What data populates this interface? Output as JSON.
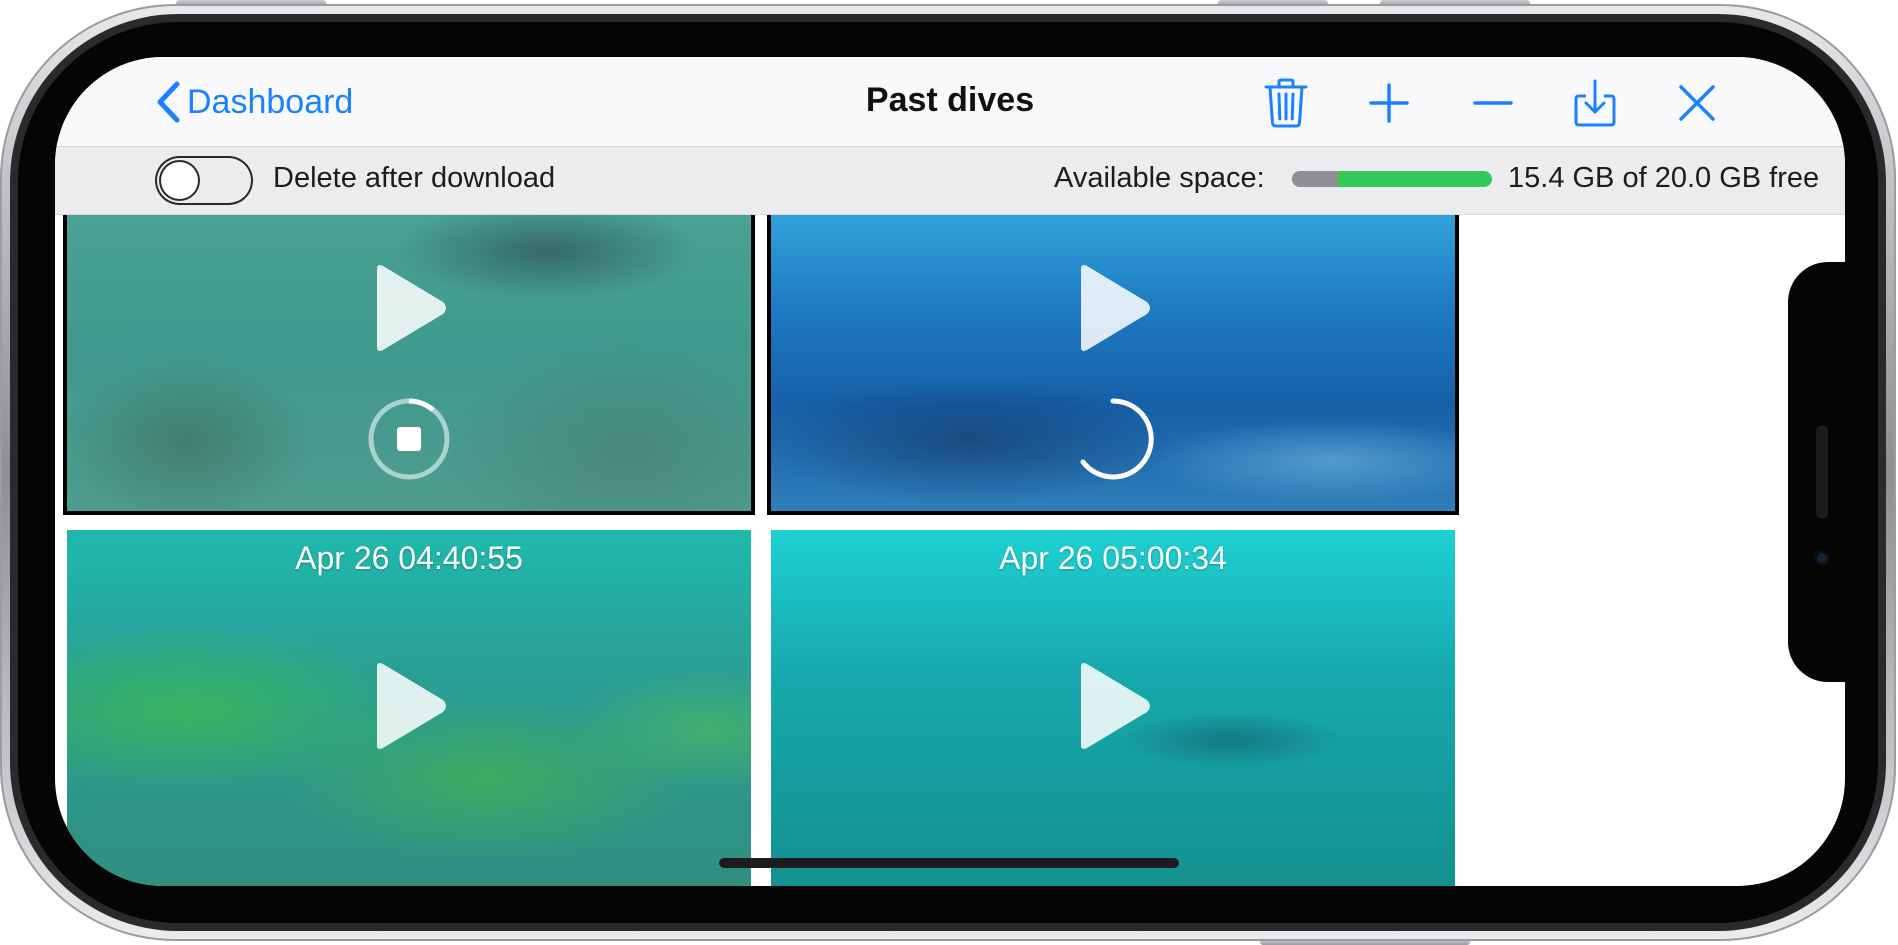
{
  "nav": {
    "back_label": "Dashboard",
    "title": "Past dives",
    "icons": [
      "trash-icon",
      "plus-icon",
      "minus-icon",
      "download-icon",
      "close-icon"
    ]
  },
  "settings": {
    "toggle_label": "Delete after download",
    "toggle_on": false,
    "space_label": "Available space:",
    "space_free_fraction": 0.77,
    "space_text": "15.4 GB of 20.0 GB free"
  },
  "videos": [
    {
      "date": "",
      "state": "downloading-stop",
      "selected": true
    },
    {
      "date": "",
      "state": "loading",
      "selected": true
    },
    {
      "date": "Apr 26 04:40:55",
      "state": "idle",
      "selected": false
    },
    {
      "date": "Apr 26 05:00:34",
      "state": "idle",
      "selected": false
    }
  ],
  "colors": {
    "accent": "#1a82ff",
    "space_free": "#34c759",
    "space_used": "#8e8e93"
  }
}
